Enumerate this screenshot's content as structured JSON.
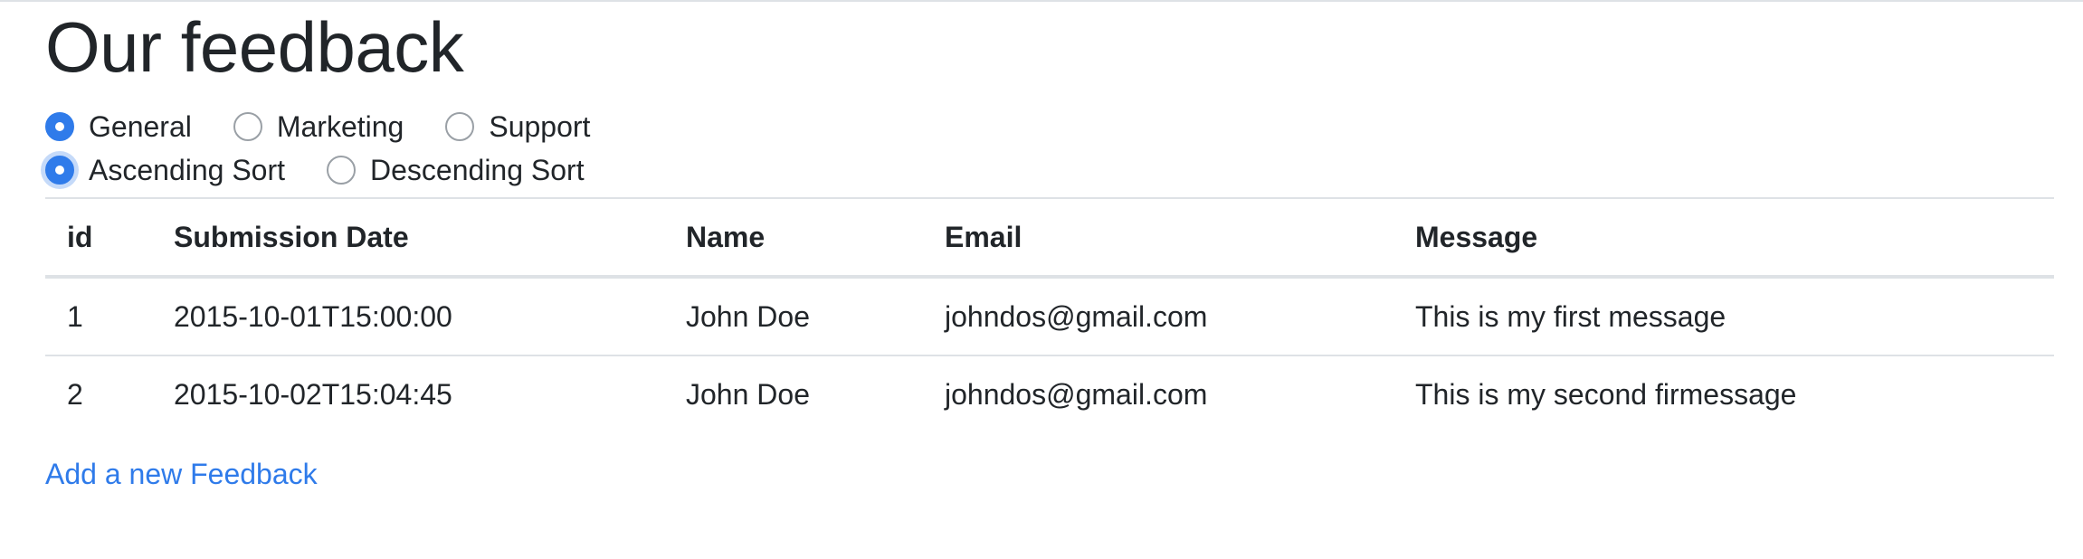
{
  "page": {
    "title": "Our feedback"
  },
  "category_filter": {
    "options": [
      {
        "label": "General",
        "checked": true
      },
      {
        "label": "Marketing",
        "checked": false
      },
      {
        "label": "Support",
        "checked": false
      }
    ]
  },
  "sort_filter": {
    "options": [
      {
        "label": "Ascending Sort",
        "checked": true
      },
      {
        "label": "Descending Sort",
        "checked": false
      }
    ]
  },
  "table": {
    "headers": [
      "id",
      "Submission Date",
      "Name",
      "Email",
      "Message"
    ],
    "rows": [
      [
        "1",
        "2015-10-01T15:00:00",
        "John Doe",
        "johndos@gmail.com",
        "This is my first message"
      ],
      [
        "2",
        "2015-10-02T15:04:45",
        "John Doe",
        "johndos@gmail.com",
        "This is my second firmessage"
      ]
    ]
  },
  "links": {
    "add_feedback": "Add a new Feedback"
  },
  "colors": {
    "accent": "#2f7bea",
    "text": "#212529",
    "border": "#dee2e6"
  }
}
